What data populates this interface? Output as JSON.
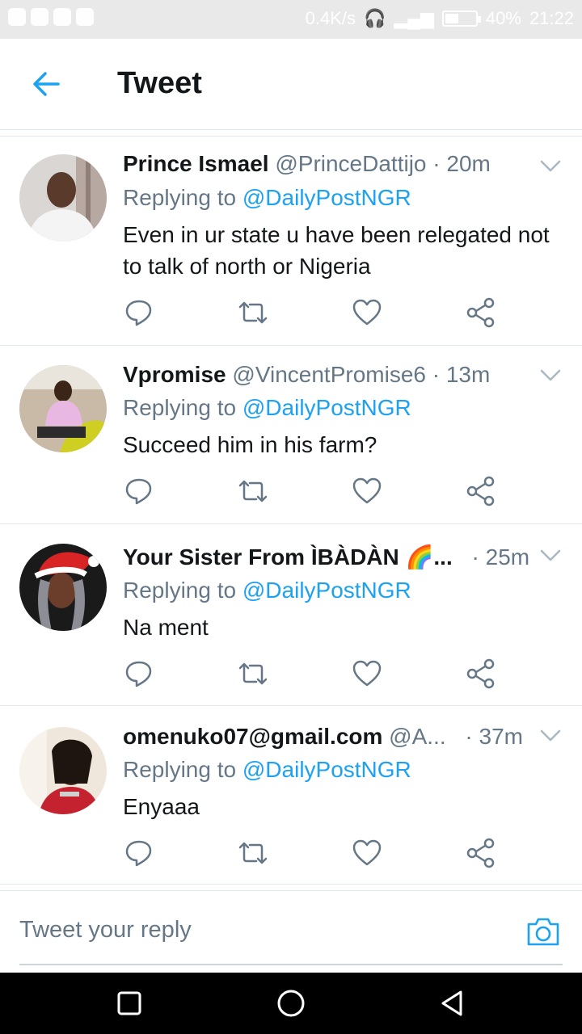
{
  "status_bar": {
    "speed": "0.4K/s",
    "battery": "40%",
    "time": "21:22",
    "battery_level_fraction": 0.4
  },
  "header": {
    "title": "Tweet",
    "back_icon": "back-arrow-icon"
  },
  "tweets": [
    {
      "name": "Prince Ismael",
      "handle": "@PrinceDattijo",
      "time": "· 20m",
      "replying_prefix": "Replying to",
      "replying_to": "@DailyPostNGR",
      "text": "Even in ur state u have been relegated not to talk of north or Nigeria"
    },
    {
      "name": "Vpromise",
      "handle": "@VincentPromise6",
      "time": "· 13m",
      "replying_prefix": "Replying to",
      "replying_to": "@DailyPostNGR",
      "text": "Succeed him in his farm?"
    },
    {
      "name": "Your Sister From ÌBÀDÀN 🌈...",
      "handle": "",
      "time": "· 25m",
      "replying_prefix": "Replying to",
      "replying_to": "@DailyPostNGR",
      "text": "Na ment"
    },
    {
      "name": "omenuko07@gmail.com",
      "handle": "@A...",
      "time": "· 37m",
      "replying_prefix": "Replying to",
      "replying_to": "@DailyPostNGR",
      "text": "Enyaaa"
    }
  ],
  "reply_bar": {
    "placeholder": "Tweet your reply",
    "camera_icon": "camera-icon"
  },
  "colors": {
    "accent": "#1da1f2",
    "secondary_text": "#657786",
    "divider": "#e1e8ed"
  }
}
